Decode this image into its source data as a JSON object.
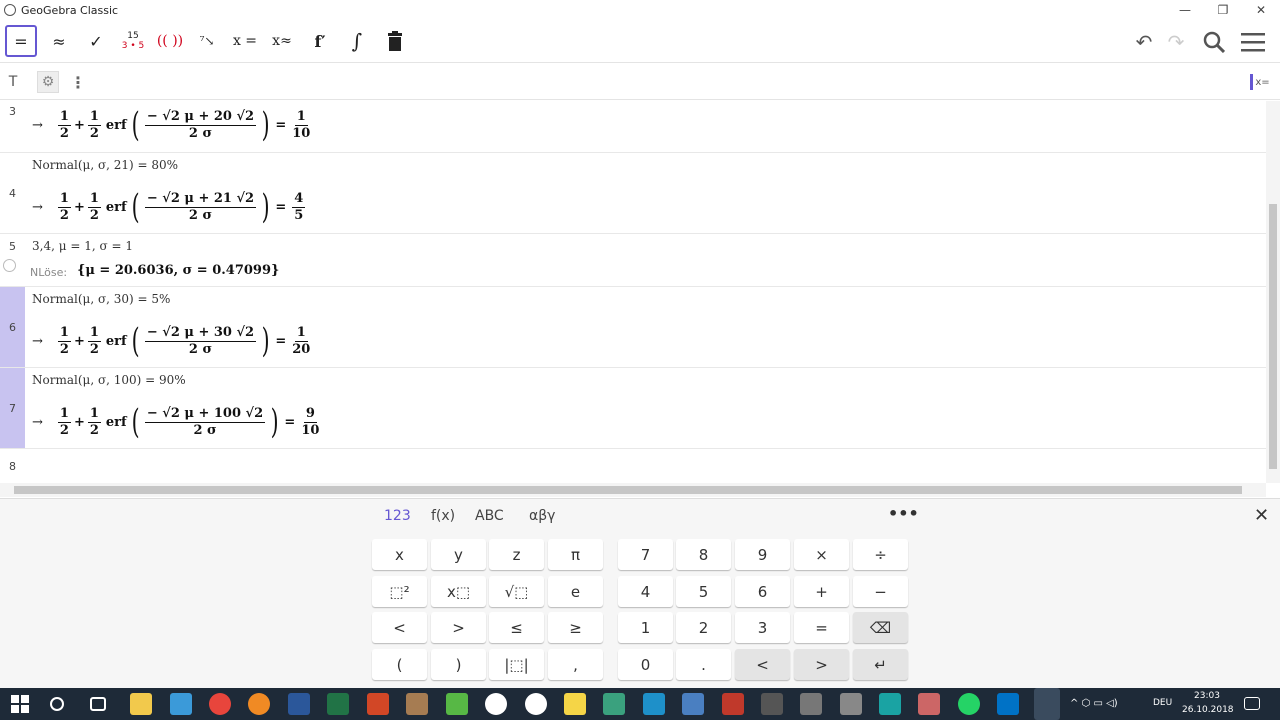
{
  "window": {
    "title": "GeoGebra Classic",
    "minimize": "—",
    "restore": "❐",
    "close": "✕"
  },
  "toolbar": {
    "tools": [
      {
        "name": "evaluate",
        "label": "=",
        "selected": true
      },
      {
        "name": "numeric",
        "label": "≈"
      },
      {
        "name": "keep-input",
        "label": "✓"
      },
      {
        "name": "factor",
        "label_top": "15",
        "label_bottom": "3 • 5"
      },
      {
        "name": "expand",
        "label": "(( ))"
      },
      {
        "name": "substitute",
        "label": "⁷↘"
      },
      {
        "name": "solve",
        "label": "x ="
      },
      {
        "name": "solve-numerically",
        "label": "x≈"
      },
      {
        "name": "derivative",
        "label": "f′"
      },
      {
        "name": "integral",
        "label": "∫"
      },
      {
        "name": "delete",
        "label": "🗑"
      }
    ],
    "undo_icon": "↶",
    "redo_icon": "↷",
    "search_icon": "⚲",
    "menu_icon": "≡"
  },
  "stylebar": {
    "text_style": "T",
    "settings_icon": "⚙",
    "more_icon": "⋮",
    "view_toggle": "x="
  },
  "cas": {
    "rows": [
      {
        "num": "3",
        "input": "",
        "output": {
          "a": "− √2 μ + 20 √2",
          "b": "2 σ",
          "rhs_num": "1",
          "rhs_den": "10"
        }
      },
      {
        "num": "4",
        "input": "Normal(μ, σ, 21)  =  80%",
        "output": {
          "a": "− √2 μ + 21 √2",
          "b": "2 σ",
          "rhs_num": "4",
          "rhs_den": "5"
        }
      },
      {
        "num": "5",
        "input": "3,4, μ = 1, σ = 1",
        "nl_label": "NLöse:",
        "nl_value": "{μ = 20.6036, σ = 0.47099}"
      },
      {
        "num": "6",
        "input": "Normal(μ, σ, 30)  =  5%",
        "output": {
          "a": "− √2 μ + 30 √2",
          "b": "2 σ",
          "rhs_num": "1",
          "rhs_den": "20"
        }
      },
      {
        "num": "7",
        "input": "Normal(μ, σ, 100)  =  90%",
        "output": {
          "a": "− √2 μ + 100 √2",
          "b": "2 σ",
          "rhs_num": "9",
          "rhs_den": "10"
        }
      },
      {
        "num": "8",
        "input": ""
      }
    ],
    "common": {
      "arrow": "→",
      "half_num": "1",
      "half_den": "2",
      "plus": "+",
      "erf": "erf",
      "eq": "=",
      "lparen": "(",
      "rparen": ")"
    }
  },
  "keyboard": {
    "tabs": [
      "123",
      "f(x)",
      "ABC",
      "αβγ"
    ],
    "active_tab": "123",
    "more": "•••",
    "close": "✕",
    "left_keys": [
      [
        "x",
        "y",
        "z",
        "π"
      ],
      [
        "⬚²",
        "x⬚",
        "√⬚",
        "e"
      ],
      [
        "<",
        ">",
        "≤",
        "≥"
      ],
      [
        "(",
        ")",
        "|⬚|",
        ","
      ]
    ],
    "right_keys": [
      [
        "7",
        "8",
        "9",
        "×",
        "÷"
      ],
      [
        "4",
        "5",
        "6",
        "+",
        "−"
      ],
      [
        "1",
        "2",
        "3",
        "=",
        "⌫"
      ],
      [
        "0",
        ".",
        "<",
        ">",
        "↵"
      ]
    ]
  },
  "taskbar": {
    "time": "23:03",
    "date": "26.10.2018",
    "lang": "DEU"
  }
}
